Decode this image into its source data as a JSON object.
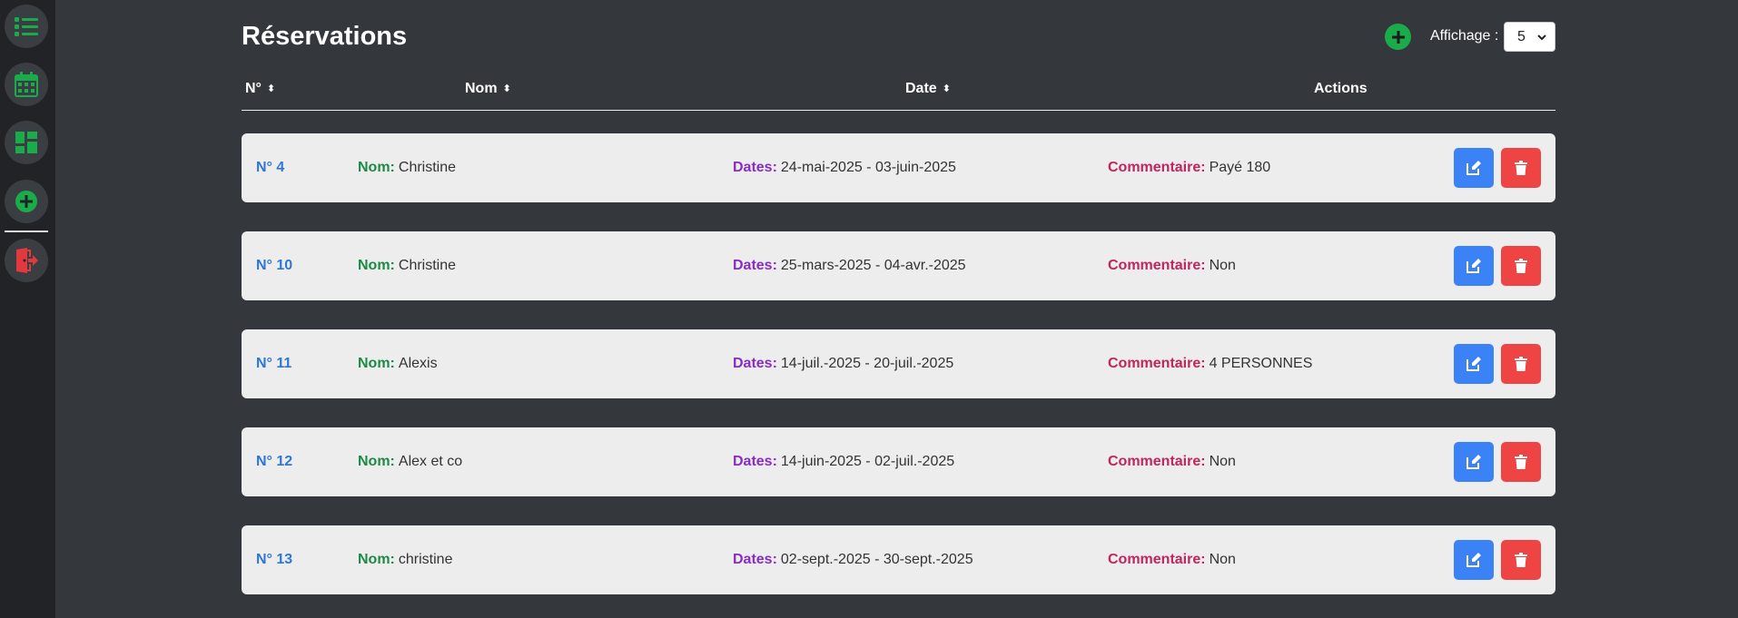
{
  "header": {
    "title": "Réservations",
    "add_icon": "plus-circle-icon",
    "affichage_label": "Affichage :",
    "affichage_value": "5"
  },
  "sidebar": {
    "items": [
      {
        "name": "list-icon"
      },
      {
        "name": "calendar-icon"
      },
      {
        "name": "dashboard-icon"
      },
      {
        "name": "plus-circle-icon"
      },
      {
        "name": "logout-icon"
      }
    ],
    "accent": "#1aab4b",
    "logout_color": "#e0393f"
  },
  "table": {
    "headers": {
      "num": "N°",
      "nom": "Nom",
      "date": "Date",
      "actions": "Actions"
    },
    "labels": {
      "nom": "Nom:",
      "dates": "Dates:",
      "commentaire": "Commentaire:"
    },
    "rows": [
      {
        "num": "N° 4",
        "nom": "Christine",
        "dates": "24-mai-2025 - 03-juin-2025",
        "commentaire": "Payé 180"
      },
      {
        "num": "N° 10",
        "nom": "Christine",
        "dates": "25-mars-2025 - 04-avr.-2025",
        "commentaire": "Non"
      },
      {
        "num": "N° 11",
        "nom": "Alexis",
        "dates": "14-juil.-2025 - 20-juil.-2025",
        "commentaire": "4 PERSONNES"
      },
      {
        "num": "N° 12",
        "nom": "Alex et co",
        "dates": "14-juin-2025 - 02-juil.-2025",
        "commentaire": "Non"
      },
      {
        "num": "N° 13",
        "nom": "christine",
        "dates": "02-sept.-2025 - 30-sept.-2025",
        "commentaire": "Non"
      }
    ]
  },
  "colors": {
    "background": "#34373c",
    "sidebar": "#212326",
    "row": "#ededed",
    "num": "#2e76d8",
    "nom_label": "#1d8a45",
    "dates_label": "#8a2cc4",
    "comment_label": "#c0255d",
    "edit_button": "#3b82f6",
    "delete_button": "#ef4444"
  }
}
